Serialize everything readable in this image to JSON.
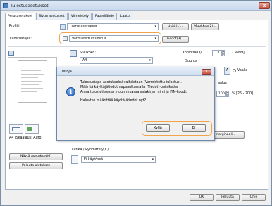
{
  "window": {
    "title": "Tulostusasetukset",
    "close_label": "x"
  },
  "tabs": [
    "Perusasetukset",
    "Sivun asetukset",
    "Viimeistely",
    "Paperilähde",
    "Laatu"
  ],
  "profile": {
    "label": "Profiili:",
    "value": "Oletusasetukset",
    "add_label": "Lisää(1)...",
    "edit_label": "Muokkaa(2)..."
  },
  "output_method": {
    "label": "Tulostustapa:",
    "value": "Varmistettu tulostus",
    "details_label": "Tiedot(3)..."
  },
  "page_size": {
    "label": "Sivukoko:",
    "value": "A4"
  },
  "copies": {
    "label": "Kopioita(Q):",
    "value": "1",
    "range": "[1 - 9999]"
  },
  "orientation": {
    "label": "Suunta",
    "landscape_label": "Vaaka"
  },
  "scaling": {
    "label": "aalus",
    "value": "100",
    "range": "% [25 - 200]"
  },
  "preview": {
    "caption": "A4 [Skaalaus: Auto]"
  },
  "side_buttons": {
    "show_settings": "Näytä asetukset(6)",
    "restore_defaults": "Palauta oletukset"
  },
  "marginal": {
    "label": "marginaali..."
  },
  "binding": {
    "label": "Laatika / Ryhmittely(C):",
    "value": "Ei käytössä"
  },
  "footer": {
    "ok": "OK",
    "cancel": "Peruuta",
    "help": "Ohje"
  },
  "dialog": {
    "title": "Tietoja",
    "close_label": "x",
    "message_lines": [
      "Tulostustapa-asetukseksi vaihdetaan [Varmistettu tulostus].",
      "Määritä käyttäjätiedot napsauttamalla [Tiedot]-painiketta.",
      "Anna tulostettaessa muun muassa asiakirjan nimi ja PIN-koodi."
    ],
    "question": "Haluatko määrittää käyttäjätiedot nyt?",
    "yes_label": "Kyllä",
    "no_label": "Ei"
  },
  "colors": {
    "highlight": "#f0a54a",
    "titlebar": "#cfdff1",
    "info_icon": "#2560b8"
  },
  "icons": [
    "printer-icon",
    "info-icon",
    "close-icon",
    "page-size-icon",
    "chevron-down-icon"
  ]
}
